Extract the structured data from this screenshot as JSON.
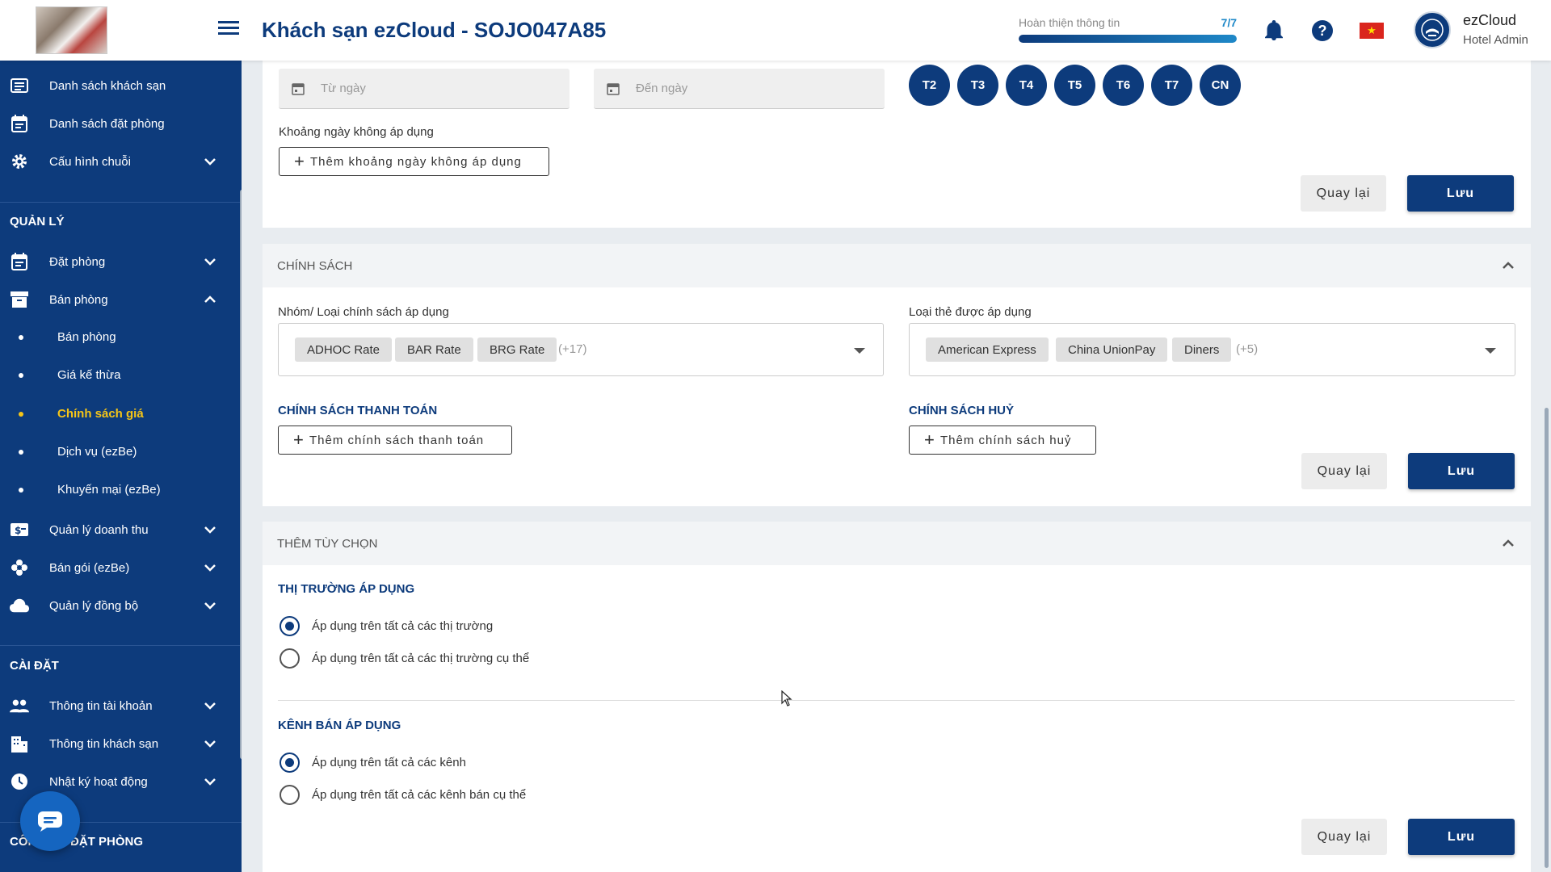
{
  "header": {
    "title": "Khách sạn ezCloud - SOJO047A85",
    "progress_label": "Hoàn thiện thông tin",
    "progress_value": "7/7",
    "progress_fraction": 1.0,
    "user_name": "ezCloud",
    "user_role": "Hotel Admin",
    "icons": [
      "menu-icon",
      "bell-icon",
      "help-icon",
      "vietnam-flag-icon",
      "avatar"
    ]
  },
  "sidebar": {
    "top_items": [
      {
        "label": "Danh sách khách sạn",
        "icon": "list-icon"
      },
      {
        "label": "Danh sách đặt phòng",
        "icon": "calendar-icon"
      },
      {
        "label": "Cấu hình chuỗi",
        "icon": "gear-icon"
      }
    ],
    "section_manage": "QUẢN LÝ",
    "manage_items": [
      {
        "label": "Đặt phòng",
        "icon": "calendar-icon"
      },
      {
        "label": "Bán phòng",
        "icon": "archive-icon"
      }
    ],
    "sub_items": [
      {
        "label": "Bán phòng"
      },
      {
        "label": "Giá kế thừa"
      },
      {
        "label": "Chính sách giá"
      },
      {
        "label": "Dịch vụ (ezBe)"
      },
      {
        "label": "Khuyến mại (ezBe)"
      }
    ],
    "manage_items_2": [
      {
        "label": "Quản lý doanh thu",
        "icon": "money-icon"
      },
      {
        "label": "Bán gói (ezBe)",
        "icon": "flower-icon"
      },
      {
        "label": "Quản lý đồng bộ",
        "icon": "cloud-icon"
      }
    ],
    "section_settings": "CÀI ĐẶT",
    "settings_items": [
      {
        "label": "Thông tin tài khoản",
        "icon": "people-icon"
      },
      {
        "label": "Thông tin khách sạn",
        "icon": "building-icon"
      },
      {
        "label": "Nhật ký hoạt động",
        "icon": "clock-icon"
      }
    ],
    "section_bottom": "CÔNG CỤ ĐẶT PHÒNG"
  },
  "date_section": {
    "from_placeholder": "Từ ngày",
    "to_placeholder": "Đến ngày",
    "days": [
      "T2",
      "T3",
      "T4",
      "T5",
      "T6",
      "T7",
      "CN"
    ],
    "excluded_label": "Khoảng ngày không áp dụng",
    "add_excluded_button": "Thêm khoảng ngày không áp dụng"
  },
  "policy": {
    "title": "CHÍNH SÁCH",
    "group_label": "Nhóm/ Loại chính sách áp dụng",
    "group_chips": [
      "ADHOC Rate",
      "BAR Rate",
      "BRG Rate"
    ],
    "group_more": "(+17)",
    "card_label": "Loại thẻ được áp dụng",
    "card_chips": [
      "American Express",
      "China UnionPay",
      "Diners"
    ],
    "card_more": "(+5)",
    "payment_heading": "CHÍNH SÁCH THANH TOÁN",
    "payment_button": "Thêm chính sách thanh toán",
    "cancel_heading": "CHÍNH SÁCH HUỶ",
    "cancel_button": "Thêm chính sách huỷ"
  },
  "options": {
    "title": "THÊM TÙY CHỌN",
    "market_heading": "THỊ TRƯỜNG ÁP DỤNG",
    "market_options": [
      {
        "label": "Áp dụng trên tất cả các thị trường",
        "checked": true
      },
      {
        "label": "Áp dụng trên tất cả các thị trường cụ thể",
        "checked": false
      }
    ],
    "channel_heading": "KÊNH BÁN ÁP DỤNG",
    "channel_options": [
      {
        "label": "Áp dụng trên tất cả các kênh",
        "checked": true
      },
      {
        "label": "Áp dụng trên tất cả các kênh bán cụ thể",
        "checked": false
      }
    ]
  },
  "actions": {
    "back": "Quay lại",
    "save": "Lưu"
  },
  "colors": {
    "primary": "#0d3b7c",
    "accent": "#1e88c8",
    "active_sub": "#f5c518"
  }
}
